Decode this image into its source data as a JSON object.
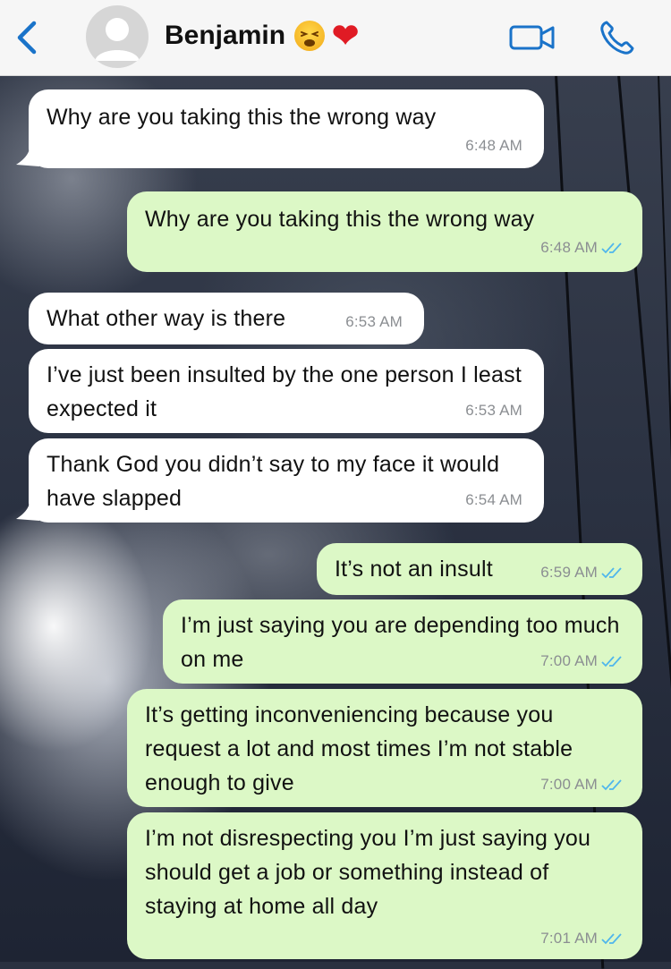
{
  "header": {
    "contact_name": "Benjamin",
    "back_icon": "chevron-left-icon",
    "video_icon": "video-camera-icon",
    "call_icon": "phone-icon",
    "accent": "#1a73c9"
  },
  "messages": [
    {
      "dir": "in",
      "text": "Why are you taking this the wrong way",
      "time": "6:48 AM"
    },
    {
      "dir": "out",
      "text": "Why are you taking this the wrong way",
      "time": "6:48 AM",
      "read": true
    },
    {
      "dir": "in",
      "text": "What other way is there",
      "time": "6:53 AM"
    },
    {
      "dir": "in",
      "text": "I’ve just been insulted by the one person I least expected it",
      "time": "6:53 AM"
    },
    {
      "dir": "in",
      "text": "Thank God you didn’t say to my face it would have slapped",
      "time": "6:54 AM"
    },
    {
      "dir": "out",
      "text": "It’s not an insult",
      "time": "6:59 AM",
      "read": true
    },
    {
      "dir": "out",
      "text": "I’m just saying you are depending too much on me",
      "time": "7:00 AM",
      "read": true
    },
    {
      "dir": "out",
      "text": "It’s getting inconveniencing because you request a lot and most times I’m not stable enough to give",
      "time": "7:00 AM",
      "read": true
    },
    {
      "dir": "out",
      "text": "I’m not disrespecting you I’m just saying you should get a job or something instead of staying at home all day",
      "time": "7:01 AM",
      "read": true
    }
  ],
  "colors": {
    "incoming_bubble": "#ffffff",
    "outgoing_bubble": "#dcf8c6",
    "read_ticks": "#4fb6ec",
    "timestamp": "#8b8e92"
  }
}
